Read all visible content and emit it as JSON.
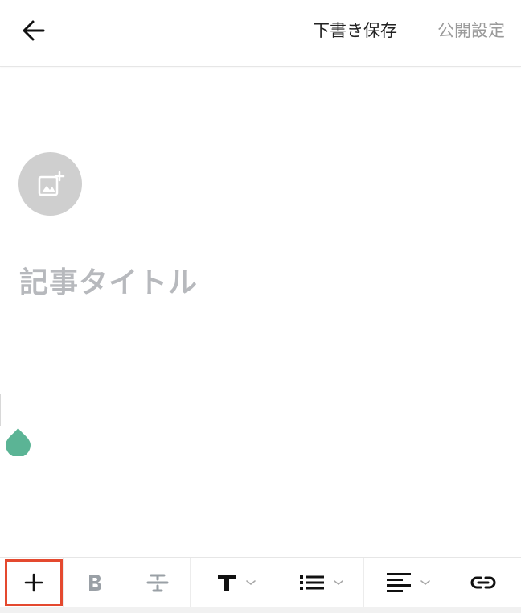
{
  "header": {
    "back_icon": "arrow-left-icon",
    "save_draft_label": "下書き保存",
    "publish_label": "公開設定"
  },
  "editor": {
    "eyecatch_icon": "add-image-icon",
    "title_placeholder": "記事タイトル"
  },
  "toolbar": {
    "items": [
      {
        "icon": "plus-icon",
        "highlighted": true
      },
      {
        "icon": "bold-icon"
      },
      {
        "icon": "strikethrough-icon"
      },
      {
        "icon": "text-heading-icon",
        "dropdown": true
      },
      {
        "icon": "list-icon",
        "dropdown": true
      },
      {
        "icon": "align-left-icon",
        "dropdown": true
      },
      {
        "icon": "link-icon"
      }
    ]
  },
  "colors": {
    "caret_handle": "#5bb495",
    "highlight_border": "#e4492f",
    "muted_text": "#9a9a9a",
    "placeholder_text": "#b7b9bd"
  }
}
